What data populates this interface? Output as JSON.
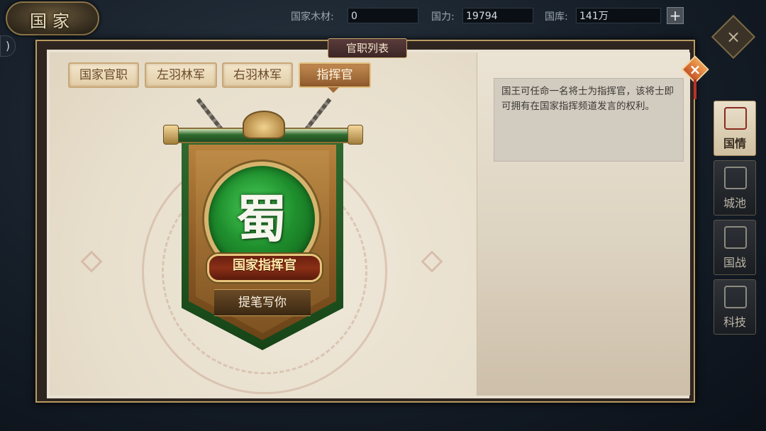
{
  "country_logo": "国家",
  "resources": {
    "wood_label": "国家木材:",
    "wood_value": "0",
    "power_label": "国力:",
    "power_value": "19794",
    "treasury_label": "国库:",
    "treasury_value": "141万",
    "plus": "+"
  },
  "left_arrow": ")",
  "panel": {
    "title": "官职列表"
  },
  "tabs": [
    {
      "label": "国家官职",
      "active": false
    },
    {
      "label": "左羽林军",
      "active": false
    },
    {
      "label": "右羽林军",
      "active": false
    },
    {
      "label": "指挥官",
      "active": true
    }
  ],
  "banner": {
    "kingdom_char": "蜀",
    "title": "国家指挥官",
    "write_button": "提笔写你"
  },
  "description": "国王可任命一名将士为指挥官，该将士即可拥有在国家指挥频道发言的权利。",
  "close_icon": "×",
  "side_nav": {
    "close_icon": "×",
    "items": [
      {
        "label": "国情",
        "icon": "scroll-icon",
        "active": true
      },
      {
        "label": "城池",
        "icon": "city-gate-icon",
        "active": false
      },
      {
        "label": "国战",
        "icon": "battle-flag-icon",
        "active": false
      },
      {
        "label": "科技",
        "icon": "tech-icon",
        "active": false
      }
    ]
  }
}
